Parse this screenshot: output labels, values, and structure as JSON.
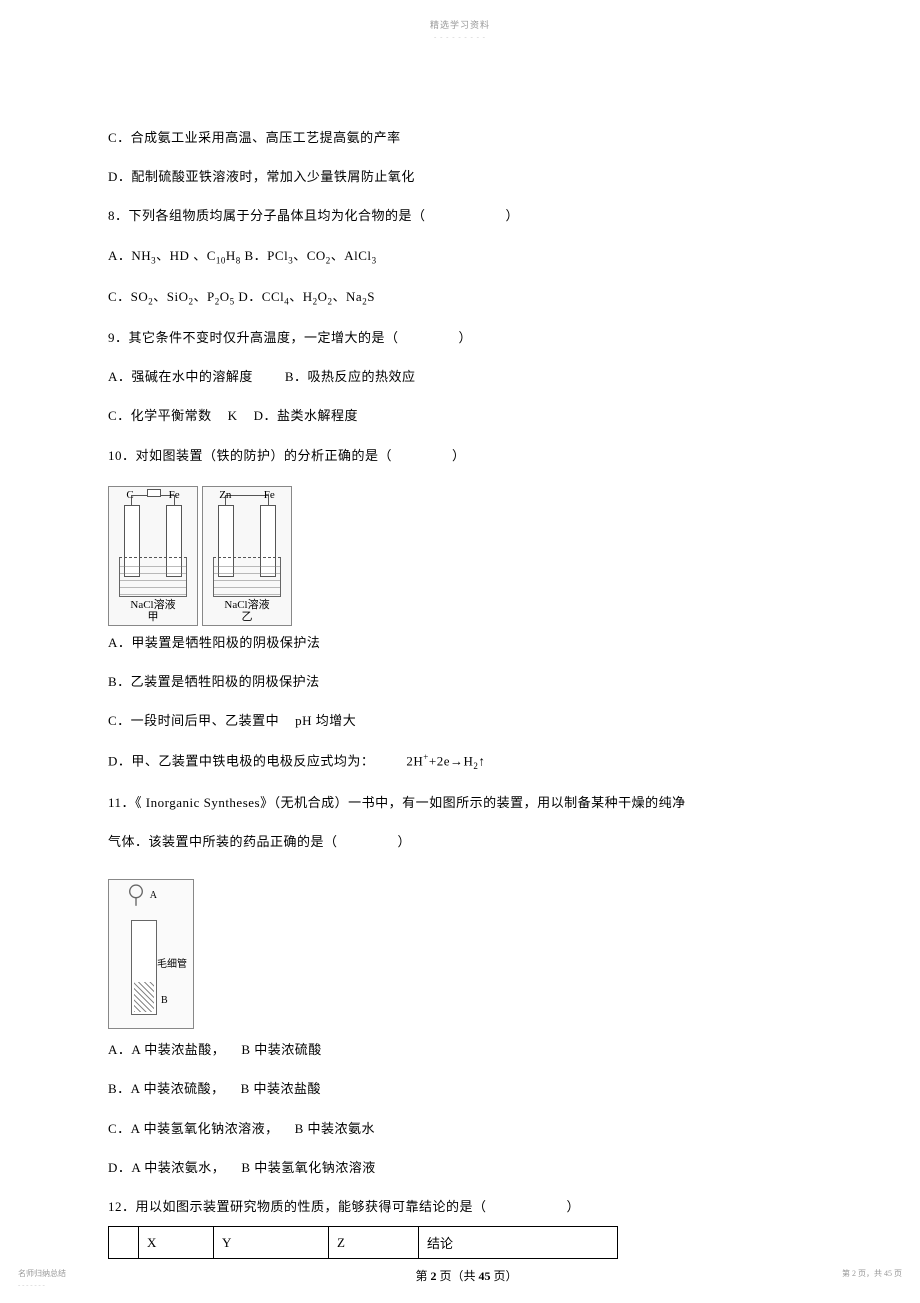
{
  "header": {
    "top": "精选学习资料",
    "sub": "- - - - - - - - -"
  },
  "q7": {
    "c": "C．合成氨工业采用高温、高压工艺提高氨的产率",
    "d": "D．配制硫酸亚铁溶液时，常加入少量铁屑防止氧化"
  },
  "q8": {
    "stem": "8．下列各组物质均属于分子晶体且均为化合物的是（",
    "paren": "）",
    "a_pre": "A．NH",
    "a_mid1": "、HD 、C",
    "a_h": "H",
    "a_end": " B．PCl",
    "a_co": "、CO",
    "a_alcl": "、AlCl",
    "c_pre": "C．SO",
    "c_sio": "、SiO",
    "c_po": "、P",
    "c_o": "O",
    "c_end": " D．CCl",
    "c_h2o2": "、H",
    "c_o2": "O",
    "c_nas": "、Na",
    "c_s": "S"
  },
  "q9": {
    "stem": "9．其它条件不变时仅升高温度，一定增大的是（",
    "paren": "）",
    "a": "A．强碱在水中的溶解度",
    "b": "B．吸热反应的热效应",
    "c": "C．化学平衡常数",
    "k": "K",
    "d": "D．盐类水解程度"
  },
  "q10": {
    "stem": "10．对如图装置（铁的防护）的分析正确的是（",
    "paren": "）",
    "beaker1_e1": "C",
    "beaker1_e2": "Fe",
    "beaker1_liq": "NaCl溶液",
    "beaker1_name": "甲",
    "beaker2_e1": "Zn",
    "beaker2_e2": "Fe",
    "beaker2_liq": "NaCl溶液",
    "beaker2_name": "乙",
    "a": "A．甲装置是牺牲阳极的阴极保护法",
    "b": "B．乙装置是牺牲阳极的阴极保护法",
    "c_pre": "C．一段时间后甲、乙装置中",
    "c_ph": "pH 均增大",
    "d_pre": "D．甲、乙装置中铁电极的电极反应式均为：",
    "d_eq1": "2H",
    "d_eq_plus": "+",
    "d_eq2": "+2e→H",
    "d_eq3": "2",
    "d_arrow": "↑"
  },
  "q11": {
    "stem_pre": "11．《 Inorganic Syntheses》（无机合成）一书中，有一如图所示的装置，用以制备某种干燥的纯净",
    "stem_mid": "气体．该装置中所装的药品正确的是（",
    "paren": "）",
    "app_a": "A",
    "app_mid": "毛细管",
    "app_b": "B",
    "a": "A．A 中装浓盐酸，",
    "a2": "B 中装浓硫酸",
    "b": "B．A 中装浓硫酸，",
    "b2": "B 中装浓盐酸",
    "c": "C．A 中装氢氧化钠浓溶液，",
    "c2": "B 中装浓氨水",
    "d": "D．A 中装浓氨水，",
    "d2": "B 中装氢氧化钠浓溶液"
  },
  "q12": {
    "stem": "12．用以如图示装置研究物质的性质，能够获得可靠结论的是（",
    "paren": "）",
    "th1": "X",
    "th2": "Y",
    "th3": "Z",
    "th4": "结论"
  },
  "footer": {
    "page_pre": "第 ",
    "page_num": "2",
    "page_mid": " 页（共 ",
    "page_total": "45",
    "page_end": " 页）",
    "left": "名师归纳总结",
    "left_sub": "- - - - - - -",
    "right": "第 2 页，共 45 页"
  }
}
